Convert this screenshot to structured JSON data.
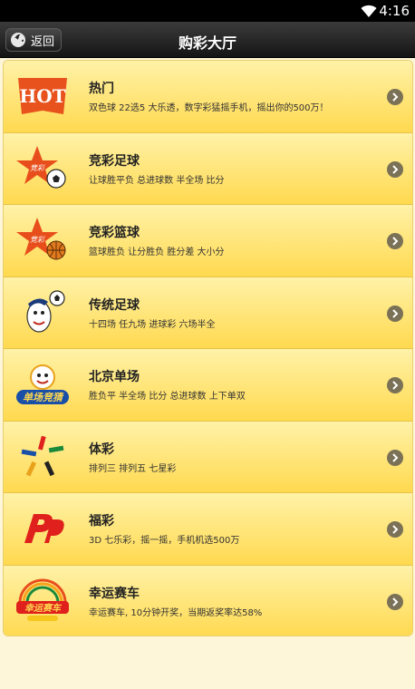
{
  "status_bar": {
    "time": "4:16",
    "wifi_icon": "wifi-icon"
  },
  "header": {
    "back_label": "返回",
    "title": "购彩大厅"
  },
  "items": [
    {
      "name": "热门",
      "desc": "双色球 22选5 大乐透，数字彩猛摇手机，摇出你的500万！",
      "icon": "hot-icon",
      "icon_text": "HOT"
    },
    {
      "name": "竞彩足球",
      "desc": "让球胜平负 总进球数 半全场 比分",
      "icon": "jingcai-football-icon",
      "icon_text": "竞彩"
    },
    {
      "name": "竞彩篮球",
      "desc": "篮球胜负 让分胜负 胜分差 大小分",
      "icon": "jingcai-basketball-icon",
      "icon_text": "竞彩"
    },
    {
      "name": "传统足球",
      "desc": "十四场 任九场 进球彩 六场半全",
      "icon": "traditional-football-icon"
    },
    {
      "name": "北京单场",
      "desc": "胜负平 半全场 比分 总进球数 上下单双",
      "icon": "beijing-single-icon",
      "icon_text": "单场竞猜"
    },
    {
      "name": "体彩",
      "desc": "排列三 排列五 七星彩",
      "icon": "sports-lottery-icon"
    },
    {
      "name": "福彩",
      "desc": "3D 七乐彩，摇一摇，手机机选500万",
      "icon": "welfare-lottery-icon"
    },
    {
      "name": "幸运赛车",
      "desc": "幸运赛车, 10分钟开奖，当期返奖率达58%",
      "icon": "lucky-racing-icon",
      "icon_text": "幸运赛车"
    }
  ],
  "colors": {
    "accent": "#ffd94f",
    "header": "#1f1f1f",
    "chevron": "#7a7157"
  }
}
